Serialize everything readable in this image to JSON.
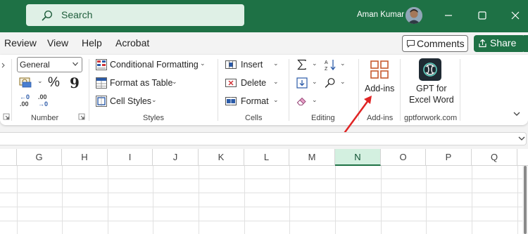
{
  "title_bar": {
    "search_placeholder": "Search",
    "user_name": "Aman Kumar"
  },
  "tabs": [
    "Review",
    "View",
    "Help",
    "Acrobat"
  ],
  "header_buttons": {
    "comments": "Comments",
    "share": "Share"
  },
  "ribbon": {
    "number": {
      "label": "Number",
      "format_value": "General",
      "percent": "%",
      "comma": "9",
      "increase_decimal_top": "←0",
      "increase_decimal_bottom": ".00",
      "decrease_decimal_top": ".00",
      "decrease_decimal_bottom": "→0"
    },
    "styles": {
      "label": "Styles",
      "conditional_formatting": "Conditional Formatting",
      "format_as_table": "Format as Table",
      "cell_styles": "Cell Styles"
    },
    "cells": {
      "label": "Cells",
      "insert": "Insert",
      "delete": "Delete",
      "format": "Format"
    },
    "editing": {
      "label": "Editing"
    },
    "addins": {
      "label": "Add-ins",
      "button": "Add-ins"
    },
    "gpt": {
      "label": "gptforwork.com",
      "button_line1": "GPT for",
      "button_line2": "Excel Word"
    }
  },
  "columns": [
    "G",
    "H",
    "I",
    "J",
    "K",
    "L",
    "M",
    "N",
    "O",
    "P",
    "Q"
  ],
  "selected_column": "N",
  "colors": {
    "brand_green": "#1e7145",
    "annotation_arrow": "#e02424",
    "selected_column_fill": "#d3f0e0"
  }
}
